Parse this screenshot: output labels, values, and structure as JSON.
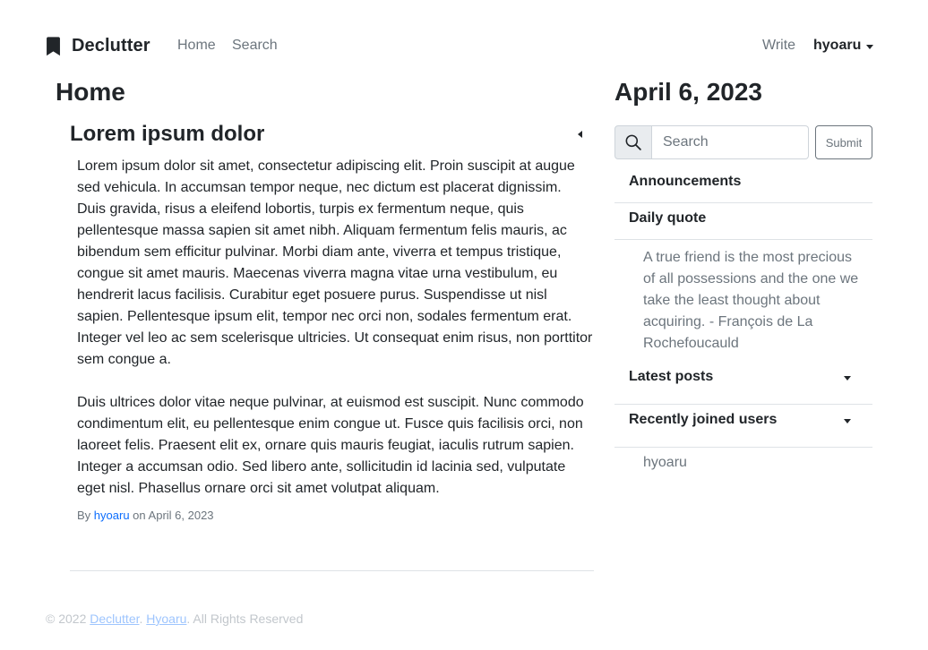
{
  "navbar": {
    "brand": "Declutter",
    "links": {
      "home": "Home",
      "search": "Search"
    },
    "write": "Write",
    "user": "hyoaru"
  },
  "main": {
    "title": "Home",
    "post": {
      "title": "Lorem ipsum dolor",
      "paragraphs": [
        "Lorem ipsum dolor sit amet, consectetur adipiscing elit. Proin suscipit at augue sed vehicula. In accumsan tempor neque, nec dictum est placerat dignissim. Duis gravida, risus a eleifend lobortis, turpis ex fermentum neque, quis pellentesque massa sapien sit amet nibh. Aliquam fermentum felis mauris, ac bibendum sem efficitur pulvinar. Morbi diam ante, viverra et tempus tristique, congue sit amet mauris. Maecenas viverra magna vitae urna vestibulum, eu hendrerit lacus facilisis. Curabitur eget posuere purus. Suspendisse ut nisl sapien. Pellentesque ipsum elit, tempor nec orci non, sodales fermentum erat. Integer vel leo ac sem scelerisque ultricies. Ut consequat enim risus, non porttitor sem congue a.",
        "Duis ultrices dolor vitae neque pulvinar, at euismod est suscipit. Nunc commodo condimentum elit, eu pellentesque enim congue ut. Fusce quis facilisis orci, non laoreet felis. Praesent elit ex, ornare quis mauris feugiat, iaculis rutrum sapien. Integer a accumsan odio. Sed libero ante, sollicitudin id lacinia sed, vulputate eget nisl. Phasellus ornare orci sit amet volutpat aliquam."
      ],
      "meta_by": "By",
      "author": "hyoaru",
      "meta_on": "on",
      "date": "April 6, 2023"
    }
  },
  "sidebar": {
    "date": "April 6, 2023",
    "search": {
      "placeholder": "Search",
      "submit": "Submit"
    },
    "sections": {
      "announcements": "Announcements",
      "daily_quote": "Daily quote",
      "quote_text": "A true friend is the most precious of all possessions and the one we take the least thought about acquiring. - François de La Rochefoucauld",
      "latest_posts": "Latest posts",
      "recent_users": "Recently joined users",
      "user": "hyoaru"
    }
  },
  "footer": {
    "prefix": "© 2022",
    "link1": "Declutter",
    "sep": ".",
    "link2": "Hyoaru",
    "suffix": ". All Rights Reserved"
  },
  "colors": {
    "text": "#212529",
    "muted": "#6c757d",
    "link": "#0d6efd",
    "border": "#dee2e6"
  },
  "icons": {
    "brand": "bookmark-icon",
    "search": "search-icon",
    "dropdown": "caret-down-icon",
    "collapse": "caret-left-icon"
  }
}
